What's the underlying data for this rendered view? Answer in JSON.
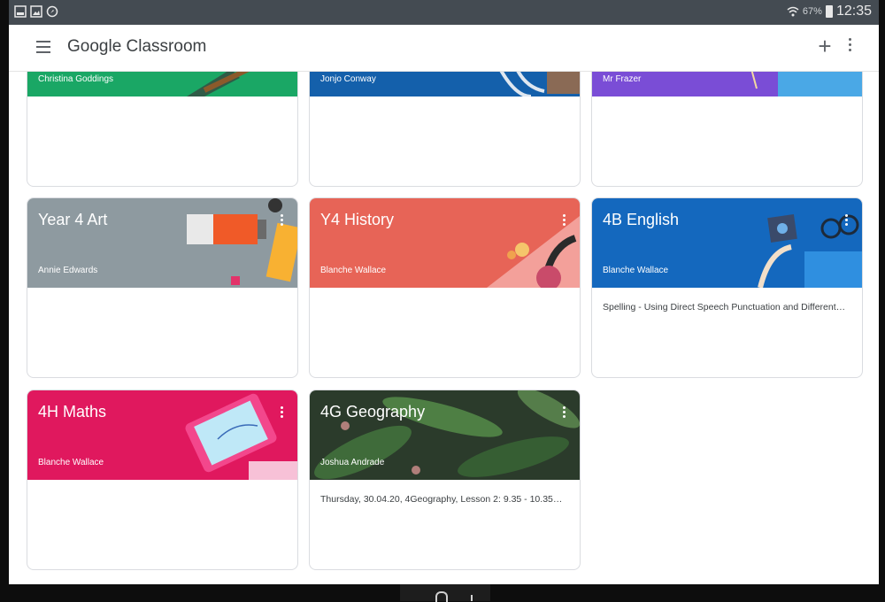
{
  "app": {
    "title": "Google Classroom"
  },
  "status_bar": {
    "battery": "67%",
    "time": "12:35",
    "icons": [
      "gallery-icon",
      "image-icon",
      "compass-icon",
      "wifi-icon",
      "battery-icon"
    ]
  },
  "colors": {
    "green": "#1aa765",
    "blue_dark": "#1460ab",
    "purple": "#7a4dd6",
    "gray": "#8e9aa0",
    "coral": "#e76457",
    "blue": "#1468be",
    "pink": "#e0185e",
    "forest": "#2b3b2b"
  },
  "classes": [
    {
      "title": "",
      "teacher": "Christina Goddings",
      "description": ""
    },
    {
      "title": "",
      "teacher": "Jonjo Conway",
      "description": ""
    },
    {
      "title": "",
      "teacher": "Mr Frazer",
      "description": ""
    },
    {
      "title": "Year 4 Art",
      "teacher": "Annie Edwards",
      "description": ""
    },
    {
      "title": "Y4 History",
      "teacher": "Blanche Wallace",
      "description": ""
    },
    {
      "title": "4B English",
      "teacher": "Blanche Wallace",
      "description": "Spelling - Using Direct Speech Punctuation and Different…"
    },
    {
      "title": "4H Maths",
      "teacher": "Blanche Wallace",
      "description": ""
    },
    {
      "title": "4G Geography",
      "teacher": "Joshua Andrade",
      "description": "Thursday, 30.04.20, 4Geography, Lesson 2: 9.35 - 10.35…"
    }
  ]
}
